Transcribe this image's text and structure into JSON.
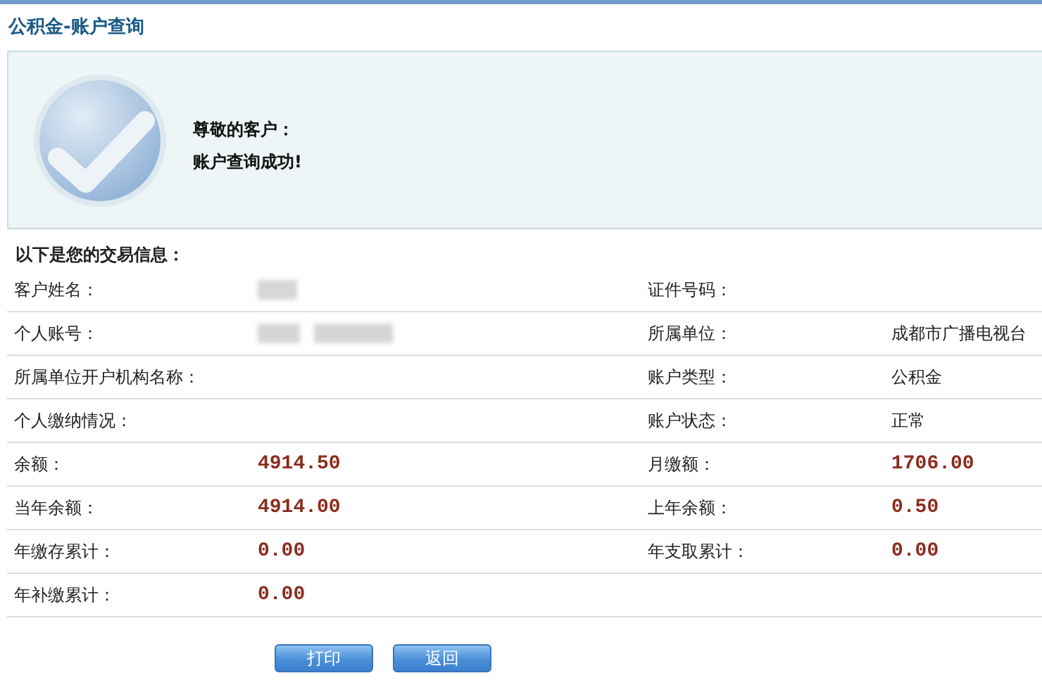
{
  "page": {
    "title": "公积金-账户查询"
  },
  "notice": {
    "greeting": "尊敬的客户：",
    "message": "账户查询成功!"
  },
  "info": {
    "heading": "以下是您的交易信息：",
    "rows": [
      {
        "cells": [
          {
            "label": "客户姓名：",
            "kind": "redacted"
          },
          {
            "label": "证件号码：",
            "kind": "text"
          }
        ]
      },
      {
        "cells": [
          {
            "label": "个人账号：",
            "kind": "redacted"
          },
          {
            "label": "所属单位：",
            "kind": "text",
            "value": "成都市广播电视台"
          }
        ]
      },
      {
        "cells": [
          {
            "label": "所属单位开户机构名称：",
            "kind": "text"
          },
          {
            "label": "账户类型：",
            "kind": "text",
            "value": "公积金"
          }
        ]
      },
      {
        "cells": [
          {
            "label": "个人缴纳情况：",
            "kind": "text"
          },
          {
            "label": "账户状态：",
            "kind": "text",
            "value": "正常"
          }
        ]
      },
      {
        "cells": [
          {
            "label": "余额：",
            "kind": "amount",
            "value": "4914.50"
          },
          {
            "label": "月缴额：",
            "kind": "amount",
            "value": "1706.00"
          }
        ]
      },
      {
        "cells": [
          {
            "label": "当年余额：",
            "kind": "amount",
            "value": "4914.00"
          },
          {
            "label": "上年余额：",
            "kind": "amount",
            "value": "0.50"
          }
        ]
      },
      {
        "cells": [
          {
            "label": "年缴存累计：",
            "kind": "amount",
            "value": "0.00"
          },
          {
            "label": "年支取累计：",
            "kind": "amount",
            "value": "0.00"
          }
        ]
      },
      {
        "cells": [
          {
            "label": "年补缴累计：",
            "kind": "amount",
            "value": "0.00"
          }
        ]
      }
    ]
  },
  "buttons": [
    "打印",
    "返回"
  ]
}
